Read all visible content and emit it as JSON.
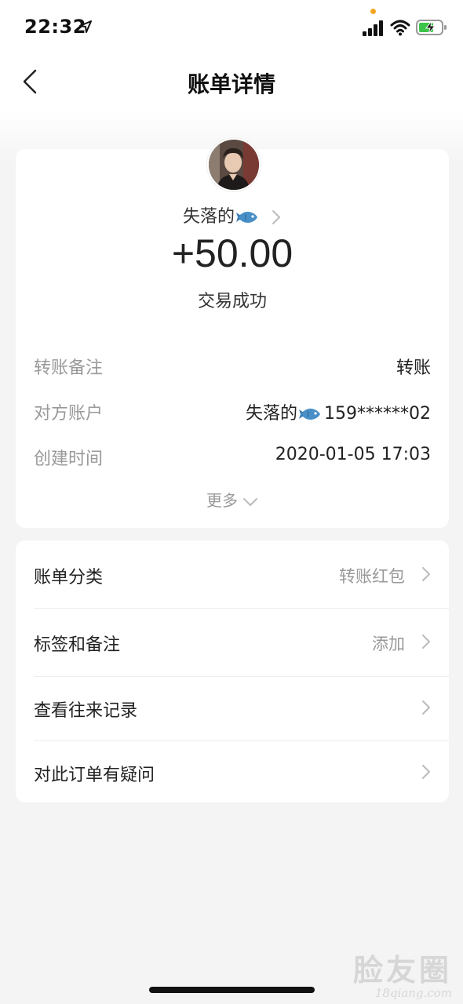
{
  "status_bar": {
    "time": "22:32"
  },
  "nav": {
    "title": "账单详情"
  },
  "summary": {
    "payee": "失落的",
    "amount": "+50.00",
    "status": "交易成功",
    "details": [
      {
        "label": "转账备注",
        "value": "转账"
      },
      {
        "label": "对方账户",
        "value_name": "失落的",
        "value_account": "159******02"
      },
      {
        "label": "创建时间",
        "value": "2020-01-05 17:03"
      }
    ],
    "more_label": "更多"
  },
  "menu": {
    "items": [
      {
        "label": "账单分类",
        "value": "转账红包"
      },
      {
        "label": "标签和备注",
        "value": "添加"
      },
      {
        "label": "查看往来记录",
        "value": ""
      },
      {
        "label": "对此订单有疑问",
        "value": ""
      }
    ]
  },
  "watermark": {
    "main": "脸友圈",
    "sub": "18qiang.com"
  },
  "colors": {
    "background": "#f4f4f4",
    "card": "#ffffff",
    "text_primary": "#222222",
    "text_secondary": "#999999",
    "fish_icon": "#4a90c8"
  }
}
